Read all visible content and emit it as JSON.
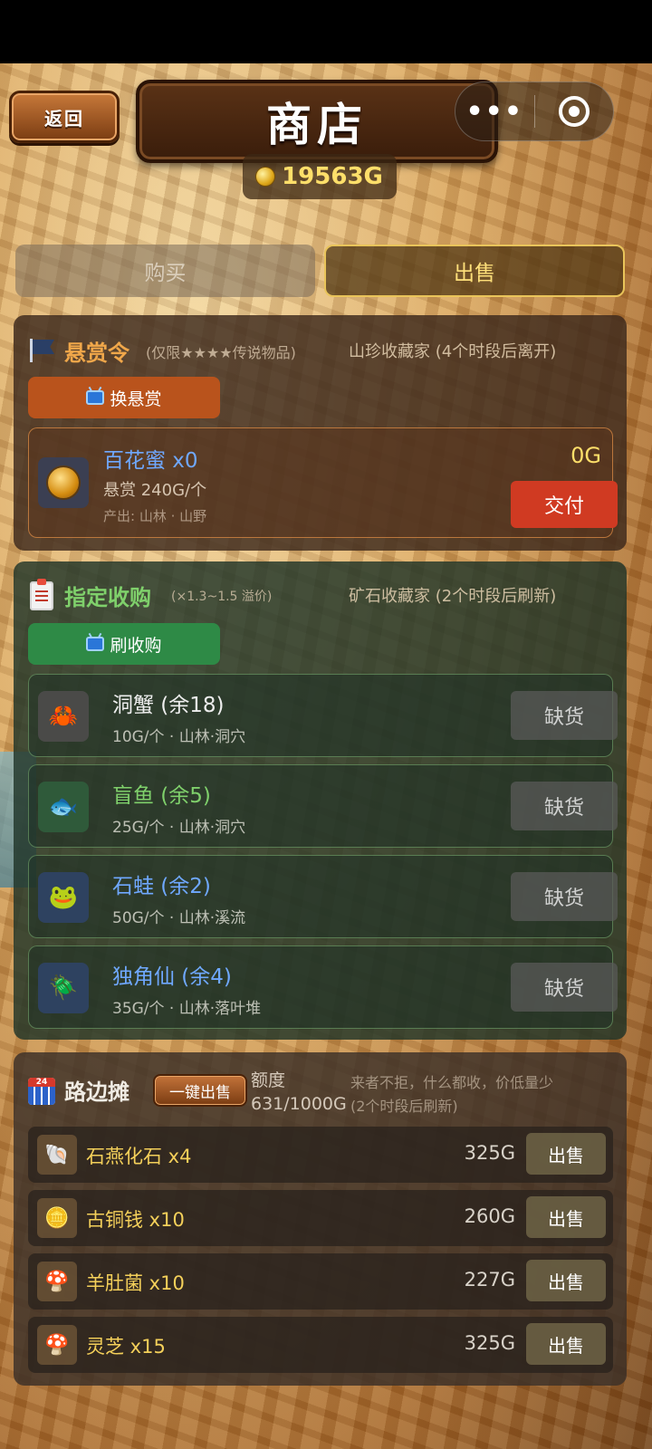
{
  "header": {
    "back_label": "返回",
    "title": "商店",
    "gold": "19563G",
    "more_label": "•••"
  },
  "tabs": {
    "buy": "购买",
    "sell": "出售"
  },
  "bounty": {
    "title": "悬赏令",
    "subtitle": "(仅限★★★★传说物品)",
    "right": "山珍收藏家 (4个时段后离开)",
    "refresh_label": "换悬赏",
    "item": {
      "name": "百花蜜 x0",
      "reward": "悬赏 240G/个",
      "origin": "产出: 山林 · 山野",
      "value": "0G",
      "deliver_label": "交付"
    }
  },
  "orders": {
    "title": "指定收购",
    "subtitle": "(×1.3~1.5 溢价)",
    "right": "矿石收藏家 (2个时段后刷新)",
    "refresh_label": "刷收购",
    "rows": [
      {
        "name": "洞蟹 (余18)",
        "sub": "10G/个 · 山林·洞穴",
        "button": "缺货",
        "color": "#e8e8e8"
      },
      {
        "name": "盲鱼 (余5)",
        "sub": "25G/个 · 山林·洞穴",
        "button": "缺货",
        "color": "#7fd06b"
      },
      {
        "name": "石蛙 (余2)",
        "sub": "50G/个 · 山林·溪流",
        "button": "缺货",
        "color": "#6fa8ff"
      },
      {
        "name": "独角仙 (余4)",
        "sub": "35G/个 · 山林·落叶堆",
        "button": "缺货",
        "color": "#6fa8ff"
      }
    ]
  },
  "street": {
    "title": "路边摊",
    "quick_sell_label": "一键出售",
    "quota_label": "额度",
    "quota_value": "631/1000G",
    "right_line1": "来者不拒，什么都收，价低量少",
    "right_line2": "(2个时段后刷新)",
    "calendar_day": "24",
    "rows": [
      {
        "name": "石燕化石 x4",
        "price": "325G",
        "button": "出售"
      },
      {
        "name": "古铜钱 x10",
        "price": "260G",
        "button": "出售"
      },
      {
        "name": "羊肚菌 x10",
        "price": "227G",
        "button": "出售"
      },
      {
        "name": "灵芝 x15",
        "price": "325G",
        "button": "出售"
      }
    ]
  },
  "colors": {
    "accent_gold": "#ffdf6a",
    "bounty_title": "#f0a74a",
    "order_title": "#7fd06b",
    "deliver_red": "#d03a22"
  }
}
